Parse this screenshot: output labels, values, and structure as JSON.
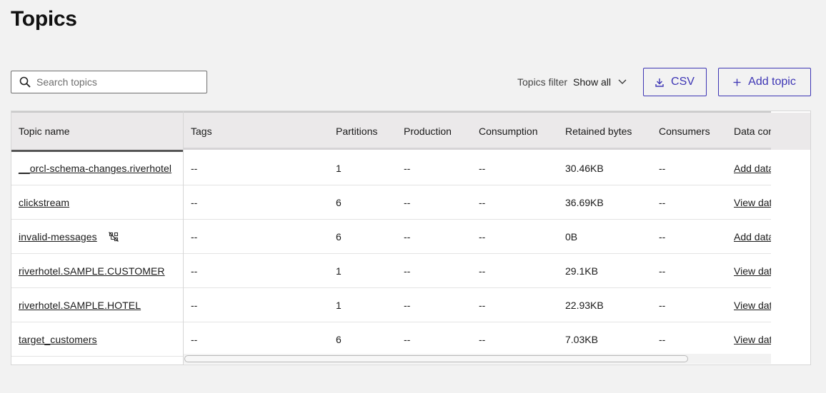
{
  "page": {
    "title": "Topics"
  },
  "search": {
    "placeholder": "Search topics",
    "value": ""
  },
  "filter": {
    "label": "Topics filter",
    "value": "Show all"
  },
  "buttons": {
    "csv": "CSV",
    "add_topic": "Add topic"
  },
  "colors": {
    "accent": "#3d35b4",
    "background": "#f2f2f2",
    "header_bg": "#ebe9ea"
  },
  "icons": {
    "search": "search-icon",
    "download": "download-icon",
    "plus": "plus-icon",
    "chevron": "chevron-down-icon",
    "no_schema": "no-schema-icon"
  },
  "table": {
    "columns": [
      "Topic name",
      "Tags",
      "Partitions",
      "Production",
      "Consumption",
      "Retained bytes",
      "Consumers",
      "Data contract"
    ],
    "rows": [
      {
        "topic": "__orcl-schema-changes.riverhotel",
        "tags": "--",
        "partitions": "1",
        "production": "--",
        "consumption": "--",
        "retained": "30.46KB",
        "consumers": "--",
        "data_contract": "Add data contract",
        "no_schema": false
      },
      {
        "topic": "clickstream",
        "tags": "--",
        "partitions": "6",
        "production": "--",
        "consumption": "--",
        "retained": "36.69KB",
        "consumers": "--",
        "data_contract": "View data contract",
        "no_schema": false
      },
      {
        "topic": "invalid-messages",
        "tags": "--",
        "partitions": "6",
        "production": "--",
        "consumption": "--",
        "retained": "0B",
        "consumers": "--",
        "data_contract": "Add data contract",
        "no_schema": true
      },
      {
        "topic": "riverhotel.SAMPLE.CUSTOMER",
        "tags": "--",
        "partitions": "1",
        "production": "--",
        "consumption": "--",
        "retained": "29.1KB",
        "consumers": "--",
        "data_contract": "View data contract",
        "no_schema": false
      },
      {
        "topic": "riverhotel.SAMPLE.HOTEL",
        "tags": "--",
        "partitions": "1",
        "production": "--",
        "consumption": "--",
        "retained": "22.93KB",
        "consumers": "--",
        "data_contract": "View data contract",
        "no_schema": false
      },
      {
        "topic": "target_customers",
        "tags": "--",
        "partitions": "6",
        "production": "--",
        "consumption": "--",
        "retained": "7.03KB",
        "consumers": "--",
        "data_contract": "View data contract",
        "no_schema": false
      }
    ]
  }
}
